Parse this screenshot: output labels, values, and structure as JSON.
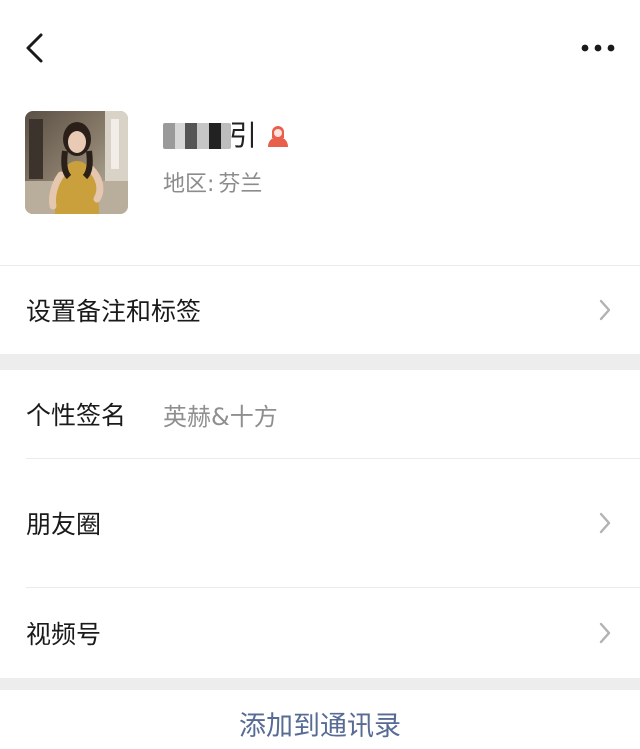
{
  "profile": {
    "name_tail": "引",
    "region_label": "地区:",
    "region_value": "芬兰"
  },
  "menu": {
    "remark_label": "设置备注和标签",
    "signature_label": "个性签名",
    "signature_value": "英赫&十方",
    "moments_label": "朋友圈",
    "channels_label": "视频号"
  },
  "actions": {
    "add_contact_label": "添加到通讯录"
  },
  "colors": {
    "link": "#576b95",
    "secondary_text": "#8f8f8f",
    "separator_band": "#ededed",
    "female_icon": "#e8604c"
  },
  "icons": {
    "back": "chevron-left-icon",
    "more": "more-dots-icon",
    "gender": "female-icon",
    "row_arrow": "chevron-right-icon"
  }
}
